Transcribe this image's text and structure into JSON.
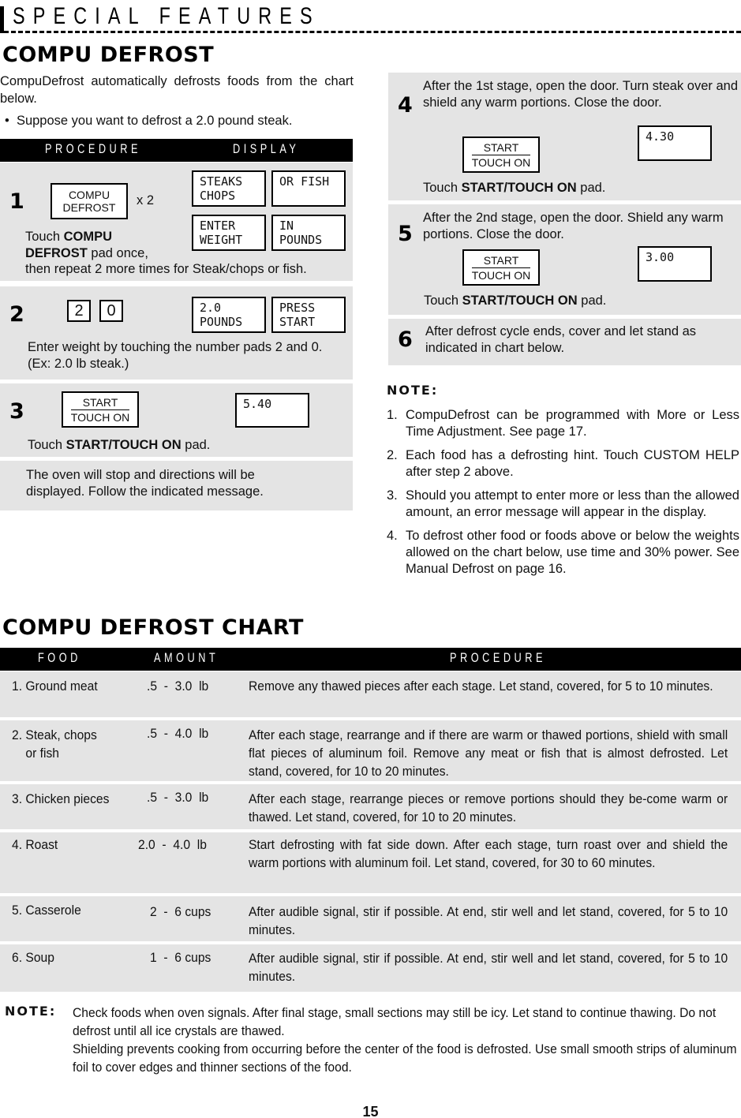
{
  "header": {
    "section_title": "SPECIAL FEATURES"
  },
  "compu_defrost": {
    "title": "COMPU DEFROST",
    "intro": "CompuDefrost automatically defrosts foods from the chart below.",
    "bullet": "Suppose you want to defrost a 2.0 pound steak.",
    "bullet_icon": "•",
    "columns": {
      "procedure": "PROCEDURE",
      "display": "DISPLAY"
    },
    "steps": [
      {
        "number": "1",
        "pad_top": "COMPU",
        "pad_bottom": "DEFROST",
        "multiplier": "x 2",
        "text_plain1": "Touch ",
        "text_bold1": "COMPU",
        "text_bold2": "DEFROST",
        "text_plain2": " pad once,",
        "text_line3": "then repeat 2 more times for Steak/chops or fish.",
        "displays": [
          "STEAKS\nCHOPS",
          "OR FISH",
          "ENTER\nWEIGHT",
          "IN\nPOUNDS"
        ]
      },
      {
        "number": "2",
        "number_pads": [
          "2",
          "0"
        ],
        "text": "Enter weight by touching the number pads 2 and 0. (Ex: 2.0 lb steak.)",
        "displays": [
          "2.0\nPOUNDS",
          "PRESS\nSTART"
        ]
      },
      {
        "number": "3",
        "pad_top": "START",
        "pad_bottom": "TOUCH ON",
        "display": "5.40",
        "text_plain1": "Touch ",
        "text_bold": "START/TOUCH ON",
        "text_plain2": " pad."
      },
      {
        "text": "The oven will stop and directions will be displayed. Follow the indicated message."
      },
      {
        "number": "4",
        "text": "After the 1st stage, open the door. Turn steak over and shield any warm portions. Close the door.",
        "pad_top": "START",
        "pad_bottom": "TOUCH ON",
        "display": "4.30",
        "text_plain1": "Touch ",
        "text_bold": "START/TOUCH ON",
        "text_plain2": " pad."
      },
      {
        "number": "5",
        "text": "After the 2nd stage, open the door. Shield any warm portions. Close the door.",
        "pad_top": "START",
        "pad_bottom": "TOUCH ON",
        "display": "3.00",
        "text_plain1": "Touch ",
        "text_bold": "START/TOUCH ON",
        "text_plain2": " pad."
      },
      {
        "number": "6",
        "text": "After defrost cycle ends, cover and let stand as indicated in chart below."
      }
    ],
    "note": {
      "heading": "NOTE:",
      "items": [
        {
          "n": "1.",
          "text": "CompuDefrost can be programmed with More or Less Time Adjustment. See page 17."
        },
        {
          "n": "2.",
          "text": "Each food has a defrosting hint. Touch CUSTOM HELP after step 2 above."
        },
        {
          "n": "3.",
          "text": "Should you attempt to enter more or less than the allowed amount, an error message will appear in the display."
        },
        {
          "n": "4.",
          "text": "To defrost other food or foods above or below the weights allowed on the chart below, use time and 30% power. See Manual Defrost on page 16."
        }
      ]
    }
  },
  "chart": {
    "title": "COMPU DEFROST CHART",
    "columns": {
      "food": "FOOD",
      "amount": "AMOUNT",
      "procedure": "PROCEDURE"
    },
    "rows": [
      {
        "food": "1. Ground meat",
        "amount": ".5  -  3.0  lb",
        "procedure": "Remove any thawed pieces after each stage. Let stand, covered, for 5 to 10 minutes."
      },
      {
        "food": "2. Steak, chops\n    or fish",
        "amount": ".5  -  4.0  lb",
        "procedure": "After each stage, rearrange and if there are warm or thawed portions, shield with small flat pieces of aluminum foil. Remove any meat or fish that is almost defrosted. Let stand, covered, for 10 to 20 minutes."
      },
      {
        "food": "3. Chicken pieces",
        "amount": ".5  -  3.0  lb",
        "procedure": "After each stage, rearrange pieces or remove portions should they be-come warm or thawed. Let stand, covered, for 10 to  20 minutes."
      },
      {
        "food": "4. Roast",
        "amount": "2.0  -  4.0  lb",
        "procedure": "Start defrosting with fat side down. After each stage, turn roast over and shield the warm portions with aluminum foil. Let stand, covered, for 30 to 60 minutes."
      },
      {
        "food": "5. Casserole",
        "amount": "2  -  6 cups",
        "procedure": "After audible signal, stir if possible. At end, stir well and let stand, covered, for 5 to 10 minutes."
      },
      {
        "food": "6. Soup",
        "amount": "1  -  6 cups",
        "procedure": "After audible signal, stir if possible. At end, stir well and let stand, covered, for 5 to 10 minutes."
      }
    ]
  },
  "bottom_note": {
    "heading": "NOTE:",
    "line1": "Check foods when oven signals. After final stage, small sections may still be icy. Let stand to continue thawing. Do not defrost until all ice crystals are thawed.",
    "line2": "Shielding prevents cooking from occurring before the center of the food is defrosted. Use small smooth strips of aluminum foil to cover edges and thinner sections of the food."
  },
  "page_number": "15"
}
